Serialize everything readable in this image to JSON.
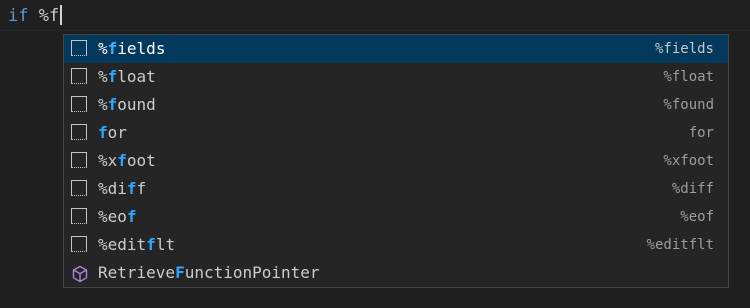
{
  "editor": {
    "keyword": "if",
    "space": " ",
    "typed": "%f"
  },
  "suggestions": [
    {
      "kind": "snippet-icon",
      "pre": "%",
      "match": "f",
      "post": "ields",
      "detail": "%fields",
      "selected": true
    },
    {
      "kind": "snippet-icon",
      "pre": "%",
      "match": "f",
      "post": "loat",
      "detail": "%float"
    },
    {
      "kind": "snippet-icon",
      "pre": "%",
      "match": "f",
      "post": "ound",
      "detail": "%found"
    },
    {
      "kind": "snippet-icon",
      "pre": "",
      "match": "f",
      "post": "or",
      "detail": "for"
    },
    {
      "kind": "snippet-icon",
      "pre": "%x",
      "match": "f",
      "post": "oot",
      "detail": "%xfoot"
    },
    {
      "kind": "snippet-icon",
      "pre": "%di",
      "match": "f",
      "post": "f",
      "detail": "%diff"
    },
    {
      "kind": "snippet-icon",
      "pre": "%eo",
      "match": "f",
      "post": "",
      "detail": "%eof"
    },
    {
      "kind": "snippet-icon",
      "pre": "%edit",
      "match": "f",
      "post": "lt",
      "detail": "%editflt"
    },
    {
      "kind": "method-cube-icon",
      "pre": "Retrieve",
      "match": "F",
      "post": "unctionPointer",
      "detail": ""
    }
  ],
  "colors": {
    "selection": "#04395e",
    "match_highlight": "#2aaaff",
    "keyword": "#569cd6",
    "method_icon": "#b180d7"
  }
}
